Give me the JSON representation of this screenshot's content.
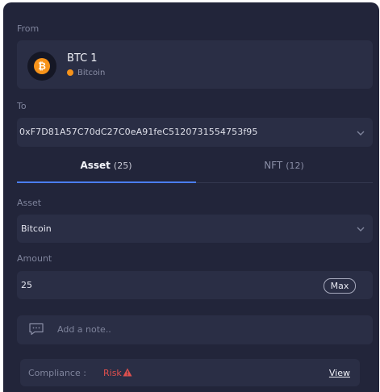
{
  "from": {
    "label": "From",
    "account_name": "BTC 1",
    "network": "Bitcoin",
    "coin_glyph": "₿",
    "coin_color": "#f7931a"
  },
  "to": {
    "label": "To",
    "address": "0xF7D81A57C70dC27C0eA91feC5120731554753f95"
  },
  "tabs": [
    {
      "label": "Asset",
      "count": "(25)",
      "active": true
    },
    {
      "label": "NFT",
      "count": "(12)",
      "active": false
    }
  ],
  "asset": {
    "label": "Asset",
    "selected": "Bitcoin"
  },
  "amount": {
    "label": "Amount",
    "value": "25",
    "max_label": "Max"
  },
  "note": {
    "placeholder": "Add a note.."
  },
  "compliance": {
    "label": "Compliance :",
    "status": "Risk",
    "status_color": "#e0504e",
    "view_label": "View"
  },
  "colors": {
    "background": "#22253a",
    "card": "#2a2e45",
    "accent": "#4a7df0"
  }
}
